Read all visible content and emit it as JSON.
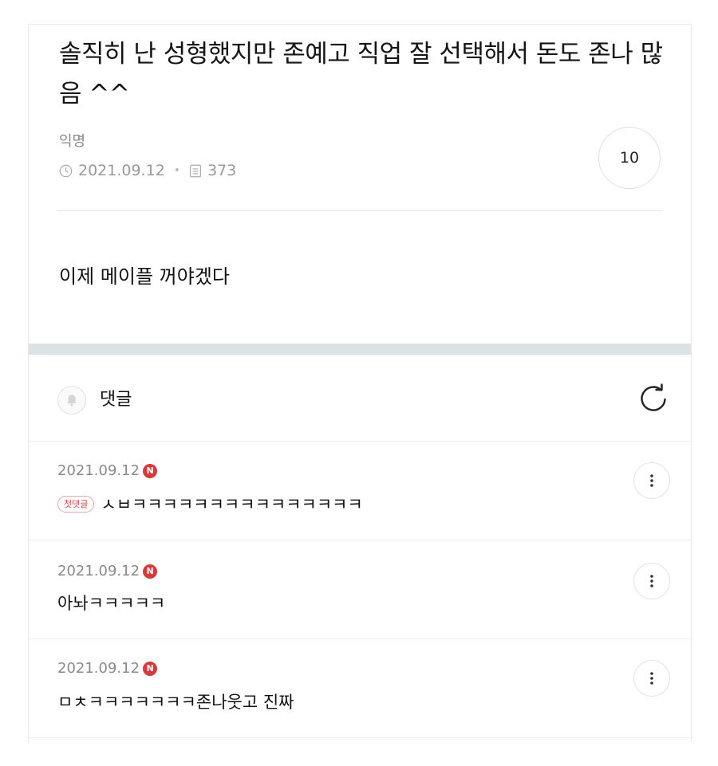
{
  "post": {
    "title": "솔직히 난 성형했지만 존예고 직업 잘 선택해서 돈도 존나 많음 ^^",
    "author": "익명",
    "date": "2021.09.12",
    "views": "373",
    "comment_count": "10",
    "body": "이제 메이플 꺼야겠다"
  },
  "comments_section": {
    "label": "댓글",
    "first_comment_badge": "첫댓글",
    "new_badge": "N",
    "items": [
      {
        "date": "2021.09.12",
        "text": "ㅅㅂㅋㅋㅋㅋㅋㅋㅋㅋㅋㅋㅋㅋㅋㅋㅋ"
      },
      {
        "date": "2021.09.12",
        "text": "아놔ㅋㅋㅋㅋㅋ"
      },
      {
        "date": "2021.09.12",
        "text": "ㅁㅊㅋㅋㅋㅋㅋㅋㅋ존나웃고 진짜"
      }
    ]
  },
  "icons": {
    "clock": "clock-icon",
    "views": "document-icon",
    "bell": "bell-icon",
    "refresh": "refresh-icon",
    "more": "kebab-icon"
  },
  "colors": {
    "new_badge": "#d83a3a",
    "first_badge_text": "#d04a4a",
    "separator_band": "#dbe2e6",
    "meta_text": "#999999"
  }
}
